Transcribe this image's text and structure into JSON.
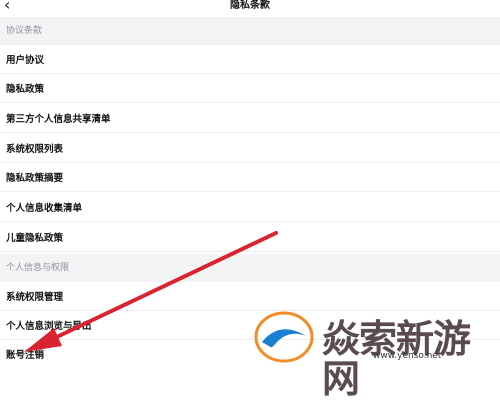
{
  "header": {
    "back_icon": "chevron-left-icon",
    "title": "隐私条款"
  },
  "sections": [
    {
      "label": "协议条款"
    },
    {
      "label": "个人信息与权限"
    }
  ],
  "agreement_items": [
    "用户协议",
    "隐私政策",
    "第三方个人信息共享清单",
    "系统权限列表",
    "隐私政策摘要",
    "个人信息收集清单",
    "儿童隐私政策"
  ],
  "permission_items": [
    "系统权限管理",
    "个人信息浏览与导出",
    "账号注销"
  ],
  "watermark": {
    "text": "焱索新游网",
    "url": "www.yenso.net"
  },
  "colors": {
    "arrow": "#d9232e",
    "section_bg": "#f2f3f5"
  }
}
